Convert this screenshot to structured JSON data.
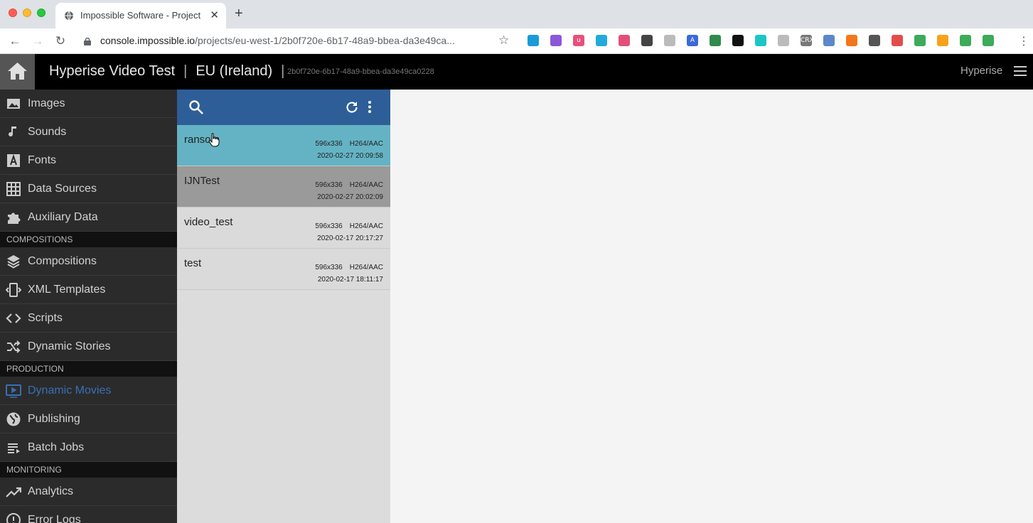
{
  "browser": {
    "tab_title": "Impossible Software - Project",
    "tab_close": "✕",
    "new_tab": "+",
    "url_host": "console.impossible.io",
    "url_path": "/projects/eu-west-1/2b0f720e-6b17-48a9-bbea-da3e49ca...",
    "nav_back": "←",
    "nav_forward": "→",
    "nav_reload": "↻",
    "bookmark_star": "☆",
    "menu": "⋮",
    "extensions": [
      {
        "icon": "globe-ext-icon",
        "label": "",
        "color": "#1a9bd7"
      },
      {
        "icon": "pen-ext-icon",
        "label": "",
        "color": "#8b57d8"
      },
      {
        "icon": "u-ext-icon",
        "label": "u",
        "color": "#e8507d"
      },
      {
        "icon": "box-ext-icon",
        "label": "",
        "color": "#22aadd"
      },
      {
        "icon": "swirl-ext-icon",
        "label": "",
        "color": "#e2507a"
      },
      {
        "icon": "frame-ext-icon",
        "label": "",
        "color": "#444444"
      },
      {
        "icon": "cc-ext-icon",
        "label": "",
        "color": "#bbbbbb"
      },
      {
        "icon": "a-ext-icon",
        "label": "A",
        "color": "#3b6ad6"
      },
      {
        "icon": "eyedropper-ext-icon",
        "label": "",
        "color": "#2f8a4e"
      },
      {
        "icon": "stack-ext-icon",
        "label": "",
        "color": "#111111"
      },
      {
        "icon": "ring-ext-icon",
        "label": "",
        "color": "#1bc6c6"
      },
      {
        "icon": "table-ext-icon",
        "label": "",
        "color": "#bbbbbb"
      },
      {
        "icon": "crx-ext-icon",
        "label": "CRX",
        "color": "#777777"
      },
      {
        "icon": "people-ext-icon",
        "label": "",
        "color": "#5b88c8"
      },
      {
        "icon": "hubspot-ext-icon",
        "label": "",
        "color": "#f5761a"
      },
      {
        "icon": "paint-ext-icon",
        "label": "",
        "color": "#555555"
      },
      {
        "icon": "spiral-ext-icon",
        "label": "",
        "color": "#e44c4c"
      },
      {
        "icon": "sprout-ext-icon",
        "label": "",
        "color": "#3cab5a"
      },
      {
        "icon": "chrome-ext-icon",
        "label": "",
        "color": "#f6a21b"
      },
      {
        "icon": "sprout2-ext-icon",
        "label": "",
        "color": "#3cab5a"
      },
      {
        "icon": "sprout3-ext-icon",
        "label": "",
        "color": "#3cab5a"
      }
    ]
  },
  "header": {
    "project_name": "Hyperise Video Test",
    "separator": "|",
    "region": "EU (Ireland)",
    "project_id": "2b0f720e-6b17-48a9-bbea-da3e49ca0228",
    "account": "Hyperise"
  },
  "sidebar": {
    "assets": [
      {
        "label": "Images",
        "icon": "image-icon"
      },
      {
        "label": "Sounds",
        "icon": "music-note-icon"
      },
      {
        "label": "Fonts",
        "icon": "font-icon"
      },
      {
        "label": "Data Sources",
        "icon": "grid-icon"
      },
      {
        "label": "Auxiliary Data",
        "icon": "puzzle-icon"
      }
    ],
    "compositions_header": "COMPOSITIONS",
    "compositions": [
      {
        "label": "Compositions",
        "icon": "layers-icon"
      },
      {
        "label": "XML Templates",
        "icon": "xml-template-icon"
      },
      {
        "label": "Scripts",
        "icon": "code-icon"
      },
      {
        "label": "Dynamic Stories",
        "icon": "shuffle-icon"
      }
    ],
    "production_header": "PRODUCTION",
    "production": [
      {
        "label": "Dynamic Movies",
        "icon": "tv-play-icon",
        "active": true
      },
      {
        "label": "Publishing",
        "icon": "globe-icon"
      },
      {
        "label": "Batch Jobs",
        "icon": "playlist-icon"
      }
    ],
    "monitoring_header": "MONITORING",
    "monitoring": [
      {
        "label": "Analytics",
        "icon": "trending-icon"
      },
      {
        "label": "Error Logs",
        "icon": "alert-icon"
      }
    ]
  },
  "movies": [
    {
      "name": "ransom",
      "size": "596x336",
      "codec": "H264/AAC",
      "date": "2020-02-27 20:09:58",
      "state": "selected"
    },
    {
      "name": "IJNTest",
      "size": "596x336",
      "codec": "H264/AAC",
      "date": "2020-02-27 20:02:09",
      "state": "hovered"
    },
    {
      "name": "video_test",
      "size": "596x336",
      "codec": "H264/AAC",
      "date": "2020-02-17 20:17:27",
      "state": "normal"
    },
    {
      "name": "test",
      "size": "596x336",
      "codec": "H264/AAC",
      "date": "2020-02-17 18:11:17",
      "state": "normal"
    }
  ],
  "colors": {
    "accent": "#2d5e97",
    "selected_row": "#64b3c4",
    "active_nav": "#3a6fb4"
  }
}
